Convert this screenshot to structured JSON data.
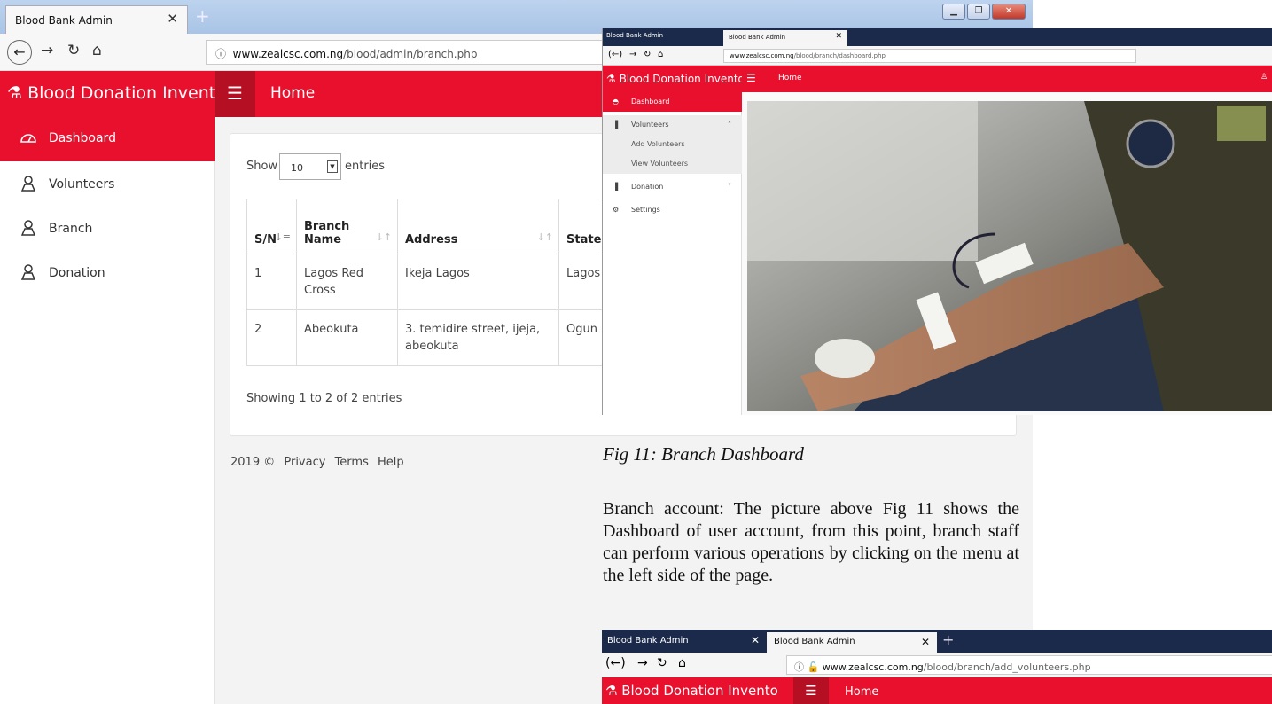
{
  "main_window": {
    "tab_title": "Blood Bank Admin",
    "url_domain": "www.zealcsc.com.ng",
    "url_path": "/blood/admin/branch.php",
    "brand": "Blood Donation Invento",
    "header_title": "Home",
    "sidebar": {
      "items": [
        {
          "label": "Dashboard",
          "icon": "dashboard-icon"
        },
        {
          "label": "Volunteers",
          "icon": "user-icon"
        },
        {
          "label": "Branch",
          "icon": "user-icon"
        },
        {
          "label": "Donation",
          "icon": "user-icon"
        }
      ]
    },
    "table_controls": {
      "show_label": "Show",
      "entries_value": "10",
      "entries_label": "entries"
    },
    "table": {
      "headers": [
        "S/N",
        "Branch Name",
        "Address",
        "State"
      ],
      "rows": [
        [
          "1",
          "Lagos Red Cross",
          "Ikeja Lagos",
          "Lagos"
        ],
        [
          "2",
          "Abeokuta",
          "3. temidire street, ijeja, abeokuta",
          "Ogun"
        ]
      ],
      "info": "Showing 1 to 2 of 2 entries"
    },
    "footer": {
      "copyright": "2019 ©",
      "links": [
        "Privacy",
        "Terms",
        "Help"
      ]
    }
  },
  "overlay_dashboard": {
    "tabs": [
      "Blood Bank Admin",
      "Blood Bank Admin"
    ],
    "url_domain": "www.zealcsc.com.ng",
    "url_path": "/blood/branch/dashboard.php",
    "brand": "Blood Donation Invento",
    "header_title": "Home",
    "sidebar": {
      "dashboard": "Dashboard",
      "volunteers": "Volunteers",
      "add_volunteers": "Add Volunteers",
      "view_volunteers": "View Volunteers",
      "donation": "Donation",
      "settings": "Settings"
    }
  },
  "document": {
    "caption": "Fig 11: Branch Dashboard",
    "paragraph": "Branch account: The picture above Fig 11 shows the Dashboard of user account, from this point, branch staff can perform various operations by clicking on the menu at the left side of the page."
  },
  "overlay_add_volunteers": {
    "tabs": [
      "Blood Bank Admin",
      "Blood Bank Admin"
    ],
    "url_domain": "www.zealcsc.com.ng",
    "url_path": "/blood/branch/add_volunteers.php",
    "brand": "Blood Donation Invento",
    "header_title": "Home"
  },
  "colors": {
    "brand_red": "#e8102d",
    "brand_dark_red": "#b50f23",
    "tab_dark": "#1b2a4a"
  }
}
